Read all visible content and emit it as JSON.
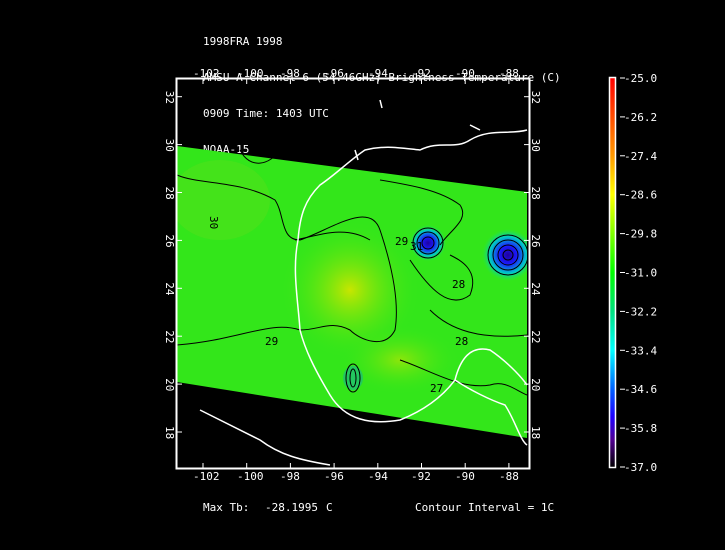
{
  "title_lines": [
    "1998FRA 1998",
    "AMSU-A Channel 6 (54.46GHz) Brightness Temperature (C)",
    "0909 Time: 1403 UTC",
    "NOAA-15"
  ],
  "lon_ticks": [
    "-102",
    "-100",
    "-98",
    "-96",
    "-94",
    "-92",
    "-90",
    "-88"
  ],
  "lat_ticks": [
    "18",
    "20",
    "22",
    "24",
    "26",
    "28",
    "30",
    "32"
  ],
  "colorbar": {
    "labels": [
      "-25.0",
      "-26.2",
      "-27.4",
      "-28.6",
      "-29.8",
      "-31.0",
      "-32.2",
      "-33.4",
      "-34.6",
      "-35.8",
      "-37.0"
    ],
    "range": [
      -37.0,
      -25.0
    ]
  },
  "contour_labels": [
    "30",
    "29",
    "28",
    "29",
    "28",
    "27",
    "31"
  ],
  "footer": {
    "max_label": "Max Tb:",
    "max_value": "-28.1995",
    "max_unit": "C",
    "contour_interval": "Contour Interval = 1C"
  },
  "colors": {
    "swath": "#33e61a",
    "warm": "#b8e600",
    "cold": "#1a1aff",
    "coast": "#ffffff"
  }
}
